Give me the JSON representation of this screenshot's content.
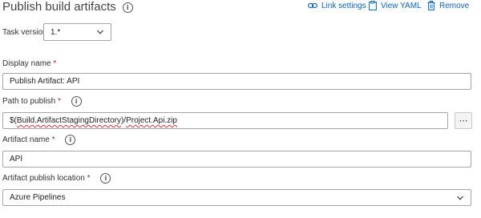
{
  "header": {
    "title": "Publish build artifacts",
    "link_settings": "Link settings",
    "view_yaml": "View YAML",
    "remove": "Remove",
    "accent_color": "#0b63b2"
  },
  "task_version": {
    "label": "Task version",
    "value": "1.*"
  },
  "display_name": {
    "label": "Display name",
    "required_mark": "*",
    "value": "Publish Artifact: API"
  },
  "path_to_publish": {
    "label": "Path to publish",
    "required_mark": "*",
    "value_part1": "$(",
    "value_part2": "Build.ArtifactStagingDirectory",
    "value_part3": ")/",
    "value_part4": "Project.Api.zip",
    "more_label": "⋯"
  },
  "artifact_name": {
    "label": "Artifact name",
    "required_mark": "*",
    "value": "API"
  },
  "publish_location": {
    "label": "Artifact publish location",
    "required_mark": "*",
    "value": "Azure Pipelines"
  },
  "icons": {
    "info": "info-icon",
    "link": "link-icon",
    "yaml": "clipboard-icon",
    "remove": "trash-icon",
    "chevron": "chevron-down-icon"
  }
}
